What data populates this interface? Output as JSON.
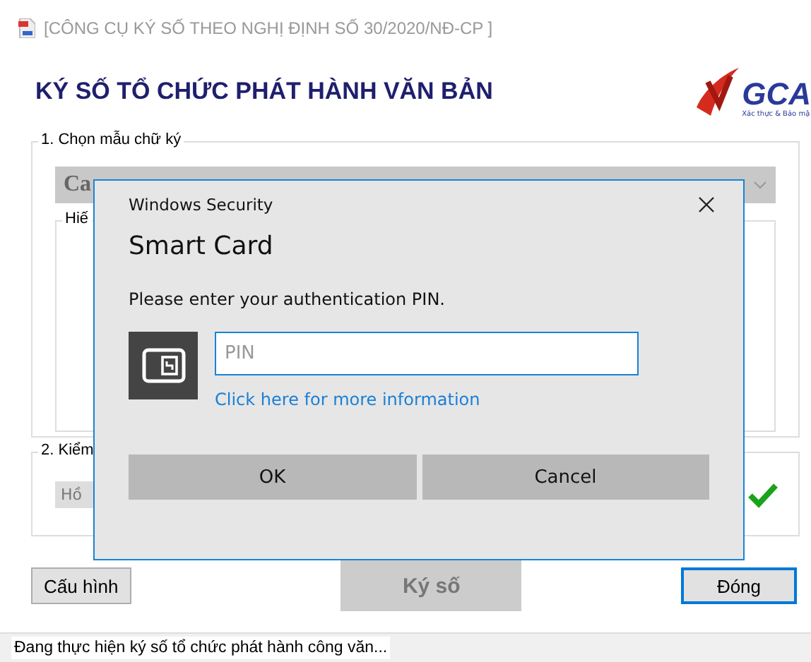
{
  "window": {
    "title": "[CÔNG CỤ KÝ SỐ THEO NGHỊ ĐỊNH SỐ 30/2020/NĐ-CP ]"
  },
  "header": {
    "title": "KÝ SỐ TỔ CHỨC PHÁT HÀNH VĂN BẢN",
    "logo_text": "GCA",
    "logo_tagline": "Xác thực & Bảo mậ"
  },
  "group_1": {
    "legend": "1. Chọn mẫu chữ ký",
    "template_value": "Ca",
    "preview_legend": "Hiế"
  },
  "group_2": {
    "legend": "2. Kiểm",
    "field_value": "Hồ",
    "verified": true
  },
  "buttons": [
    {
      "label": "Cấu hình",
      "kind": "normal",
      "disabled": false
    },
    {
      "label": "Ký số",
      "kind": "large",
      "disabled": true
    },
    {
      "label": "Đóng",
      "kind": "default",
      "disabled": false
    }
  ],
  "status_bar": "Đang thực hiện ký số tổ chức phát hành công văn...",
  "dialog": {
    "caption": "Windows Security",
    "title": "Smart Card",
    "message": "Please enter your authentication PIN.",
    "pin_placeholder": "PIN",
    "link": "Click here for more information",
    "buttons": [
      {
        "label": "OK"
      },
      {
        "label": "Cancel"
      }
    ]
  }
}
